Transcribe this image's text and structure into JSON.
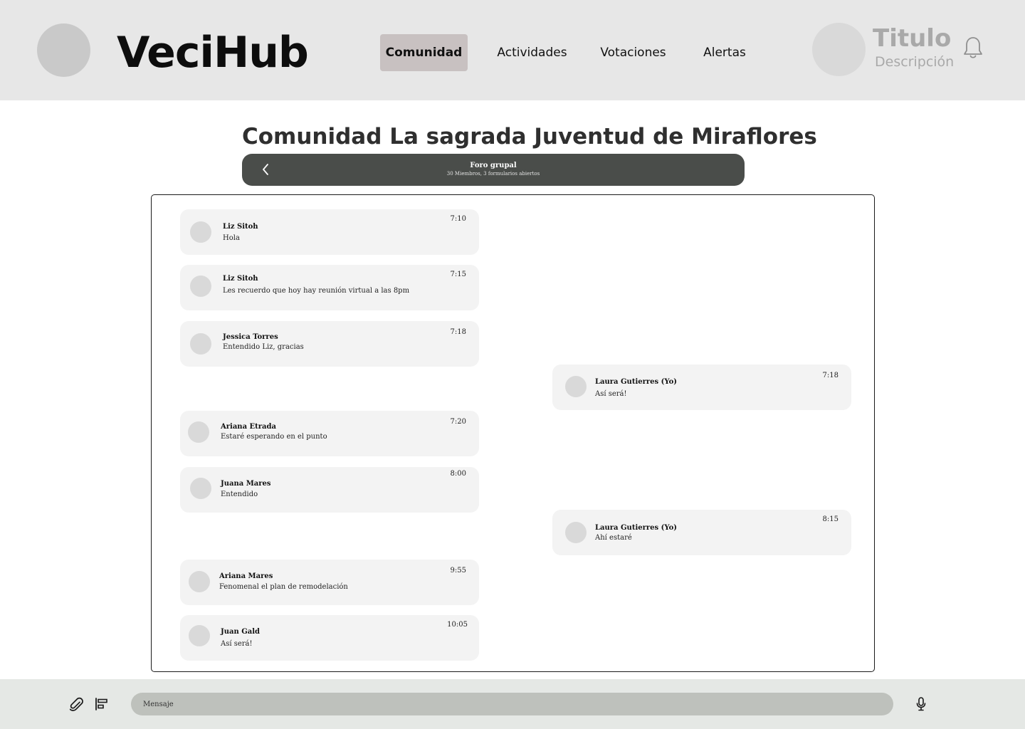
{
  "header": {
    "brand": "VeciHub",
    "nav": [
      {
        "label": "Comunidad",
        "active": true
      },
      {
        "label": "Actividades",
        "active": false
      },
      {
        "label": "Votaciones",
        "active": false
      },
      {
        "label": "Alertas",
        "active": false
      }
    ],
    "profile": {
      "title": "Titulo",
      "description": "Descripción"
    },
    "icons": {
      "notifications": "bell-icon"
    }
  },
  "page": {
    "title": "Comunidad La sagrada Juventud de Miraflores"
  },
  "forum": {
    "name": "Foro grupal",
    "subtitle": "30 Miembros, 3 formularios abiertos",
    "icons": {
      "back": "chevron-left-icon"
    }
  },
  "messages": [
    {
      "author": "Liz Sitoh",
      "text": "Hola",
      "time": "7:10",
      "side": "left"
    },
    {
      "author": "Liz Sitoh",
      "text": "Les recuerdo que hoy hay reunión virtual a las 8pm",
      "time": "7:15",
      "side": "left"
    },
    {
      "author": "Jessica Torres",
      "text": "Entendido Liz, gracias",
      "time": "7:18",
      "side": "left"
    },
    {
      "author": "Laura Gutierres (Yo)",
      "text": "Así será!",
      "time": "7:18",
      "side": "right"
    },
    {
      "author": "Ariana Etrada",
      "text": "Estaré esperando en el punto",
      "time": "7:20",
      "side": "left"
    },
    {
      "author": "Juana Mares",
      "text": "Entendido",
      "time": "8:00",
      "side": "left"
    },
    {
      "author": "Laura Gutierres (Yo)",
      "text": "Ahí estaré",
      "time": "8:15",
      "side": "right"
    },
    {
      "author": "Ariana Mares",
      "text": "Fenomenal el plan de remodelación",
      "time": "9:55",
      "side": "left"
    },
    {
      "author": "Juan Gald",
      "text": "Así será!",
      "time": "10:05",
      "side": "left"
    }
  ],
  "composer": {
    "placeholder": "Mensaje",
    "value": "",
    "icons": {
      "attach": "paperclip-icon",
      "format": "align-left-icon",
      "mic": "microphone-icon"
    }
  },
  "colors": {
    "header_bg": "#e7e7e7",
    "nav_active_bg": "#c8c1c1",
    "forum_bar_bg": "#4a4d4a",
    "bubble_bg": "#f3f3f3",
    "composer_bar_bg": "#e5e8e5",
    "input_bg": "#bec1bc"
  }
}
